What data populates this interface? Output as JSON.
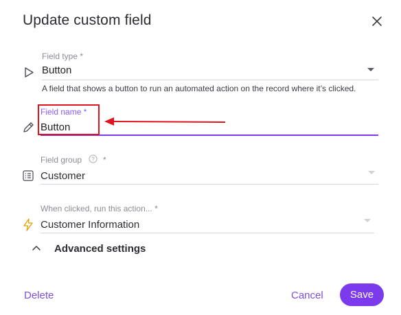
{
  "dialog": {
    "title": "Update custom field"
  },
  "fields": {
    "field_type": {
      "label": "Field type *",
      "value": "Button",
      "help": "A field that shows a button to run an automated action on the record where it’s clicked."
    },
    "field_name": {
      "label": "Field name *",
      "value": "Button"
    },
    "field_group": {
      "label": "Field group",
      "required_mark": "*",
      "value": "Customer"
    },
    "action": {
      "label": "When clicked, run this action... *",
      "value": "Customer Information"
    }
  },
  "advanced": {
    "label": "Advanced settings"
  },
  "footer": {
    "delete_label": "Delete",
    "cancel_label": "Cancel",
    "save_label": "Save"
  },
  "colors": {
    "accent": "#7c3aed",
    "link": "#7c4dde",
    "annotation": "#e0141e"
  },
  "icons": {
    "close": "close-icon",
    "field_type": "play-icon",
    "field_name": "pen-icon",
    "field_group": "list-icon",
    "action": "lightning-icon",
    "help": "question-circle-icon",
    "advanced": "chevron-up-icon"
  }
}
